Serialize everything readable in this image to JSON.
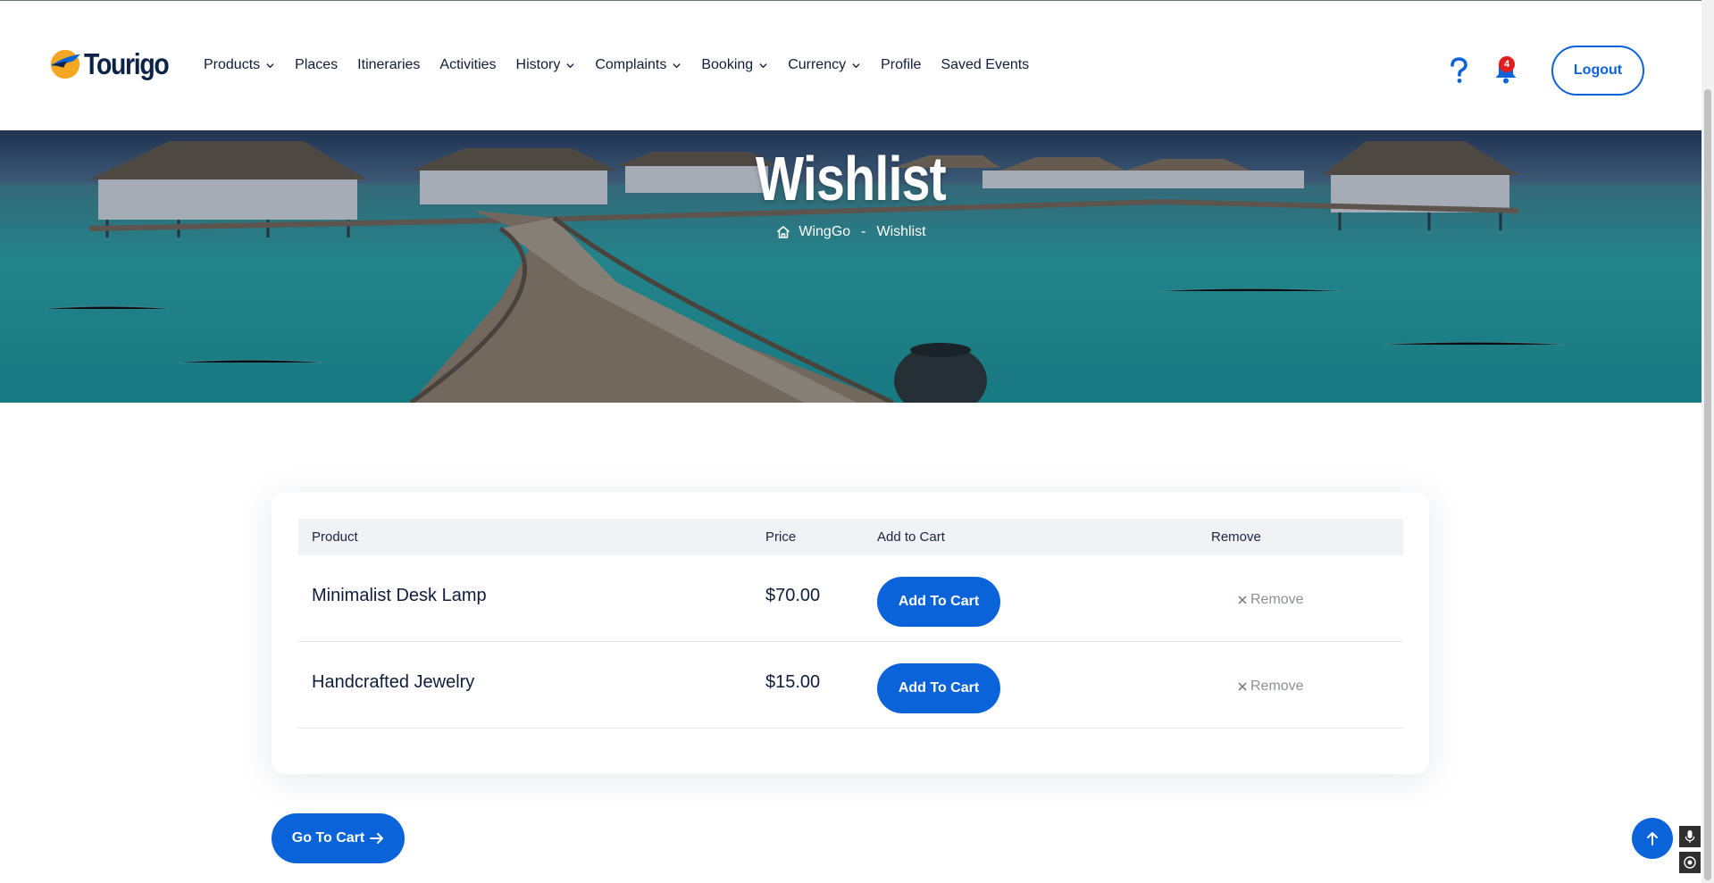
{
  "app": {
    "brand": "Tourigo"
  },
  "nav": {
    "items": [
      {
        "label": "Products",
        "has_dropdown": true
      },
      {
        "label": "Places",
        "has_dropdown": false
      },
      {
        "label": "Itineraries",
        "has_dropdown": false
      },
      {
        "label": "Activities",
        "has_dropdown": false
      },
      {
        "label": "History",
        "has_dropdown": true
      },
      {
        "label": "Complaints",
        "has_dropdown": true
      },
      {
        "label": "Booking",
        "has_dropdown": true
      },
      {
        "label": "Currency",
        "has_dropdown": true
      },
      {
        "label": "Profile",
        "has_dropdown": false
      },
      {
        "label": "Saved Events",
        "has_dropdown": false
      }
    ],
    "notification_count": "4",
    "logout_label": "Logout"
  },
  "hero": {
    "title": "Wishlist",
    "breadcrumb": {
      "home": "WingGo",
      "separator": "-",
      "current": "Wishlist"
    }
  },
  "wishlist": {
    "columns": {
      "product": "Product",
      "price": "Price",
      "add_to_cart": "Add to Cart",
      "remove": "Remove"
    },
    "rows": [
      {
        "product": "Minimalist Desk Lamp",
        "price": "$70.00",
        "add_label": "Add To Cart",
        "remove_label": "Remove"
      },
      {
        "product": "Handcrafted Jewelry",
        "price": "$15.00",
        "add_label": "Add To Cart",
        "remove_label": "Remove"
      }
    ]
  },
  "go_to_cart_label": "Go To Cart",
  "colors": {
    "accent": "#0b63d9",
    "badge": "#e11d1d",
    "text": "#0f1d3a",
    "muted": "#8a8f99",
    "table_header_bg": "#f1f2f5"
  },
  "icons": {
    "help": "question-mark-icon",
    "notifications": "bell-icon",
    "home": "home-icon",
    "remove": "close-icon",
    "go_to_cart": "arrow-right-icon",
    "scroll_top": "arrow-up-icon",
    "mic": "microphone-icon",
    "target": "target-icon"
  }
}
